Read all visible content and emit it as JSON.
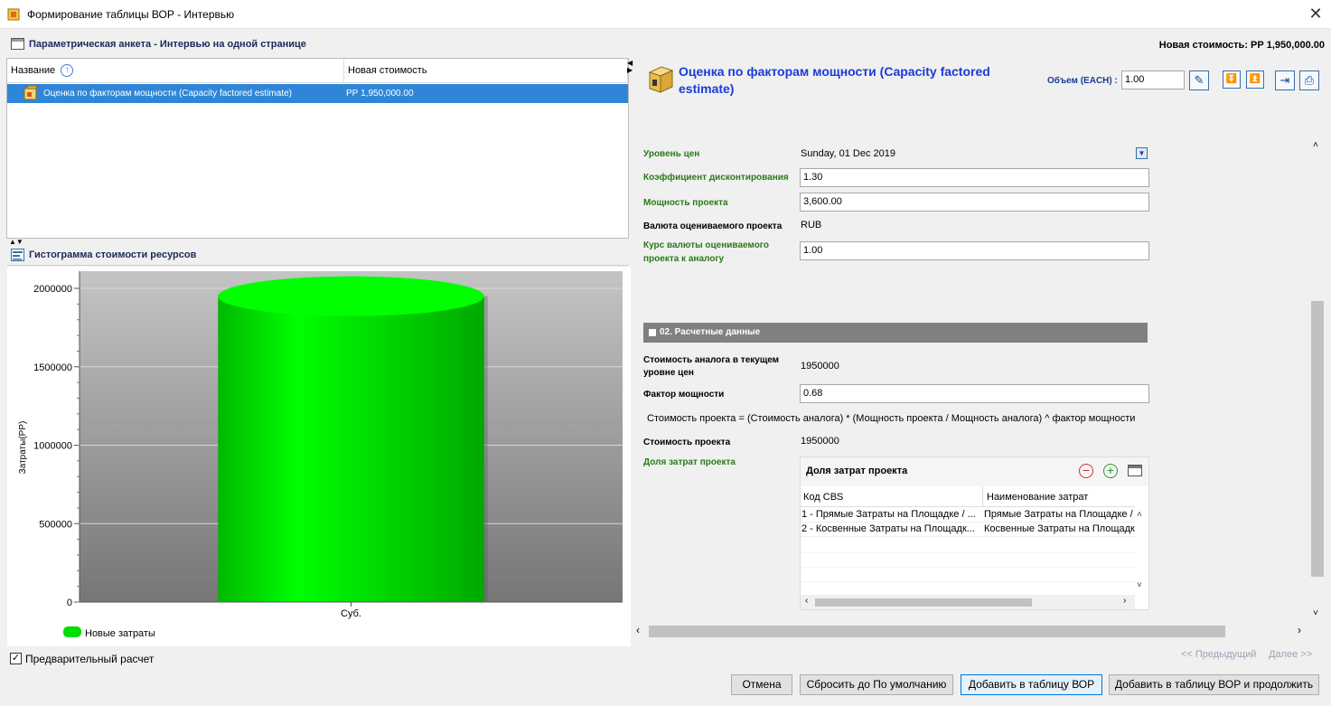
{
  "window": {
    "title": "Формирование таблицы ВОР - Интервью",
    "close_glyph": "✕"
  },
  "header": {
    "title": "Параметрическая анкета - Интервью на одной странице",
    "new_cost": "Новая стоимость: РР 1,950,000.00"
  },
  "tree": {
    "columns": [
      "Название",
      "Новая стоимость"
    ],
    "rows": [
      {
        "name": "Оценка по факторам мощности (Capacity factored estimate)",
        "cost": "РР 1,950,000.00"
      }
    ]
  },
  "chart_section": {
    "title": "Гистограмма стоимости ресурсов"
  },
  "chart_data": {
    "type": "bar",
    "categories": [
      "Суб."
    ],
    "series": [
      {
        "name": "Новые затраты",
        "values": [
          1950000
        ],
        "color": "#00e600"
      }
    ],
    "ylabel": "Затраты(РР)",
    "ylim": [
      0,
      2000000
    ],
    "yticks": [
      0,
      500000,
      1000000,
      1500000,
      2000000
    ],
    "legend": "bottom-left"
  },
  "preliminary": {
    "label": "Предварительный расчет",
    "checked": true
  },
  "item": {
    "title_line1": "Оценка по факторам мощности (Capacity factored",
    "title_line2": "estimate)",
    "qty_label": "Объем (EACH) :",
    "qty_value": "1.00"
  },
  "fields": {
    "price_level_label": "Уровень цен",
    "price_level_value": "Sunday, 01 Dec 2019",
    "discount_label": "Коэффициент дисконтирования",
    "discount_value": "1.30",
    "capacity_label": "Мощность проекта",
    "capacity_value": "3,600.00",
    "currency_label": "Валюта оцениваемого проекта",
    "currency_value": "RUB",
    "rate_label_1": "Курс валюты оцениваемого",
    "rate_label_2": "проекта к аналогу",
    "rate_value": "1.00"
  },
  "section2": {
    "title": "02. Расчетные данные",
    "analog_cost_label_1": "Стоимость аналога в текущем",
    "analog_cost_label_2": "уровне цен",
    "analog_cost_value": "1950000",
    "power_factor_label": "Фактор мощности",
    "power_factor_value": "0.68",
    "formula": "Стоимость проекта = (Стоимость аналога) * (Мощность проекта / Мощность аналога) ^ фактор мощности",
    "project_cost_label": "Стоимость проекта",
    "project_cost_value": "1950000",
    "share_label": "Доля затрат проекта"
  },
  "subgrid": {
    "title": "Доля затрат проекта",
    "columns": [
      "Код CBS",
      "Наименование затрат"
    ],
    "rows": [
      [
        "1 - Прямые Затраты на Площадке / ...",
        "Прямые Затраты на Площадке /"
      ],
      [
        "2 - Косвенные Затраты на Площадк...",
        "Косвенные Затраты на Площадк"
      ]
    ]
  },
  "nav": {
    "prev": "<< Предыдущий",
    "next": "Далее >>"
  },
  "buttons": {
    "cancel": "Отмена",
    "reset": "Сбросить до По умолчанию",
    "add": "Добавить в таблицу ВОР",
    "add_continue": "Добавить в таблицу ВОР и продолжить"
  }
}
